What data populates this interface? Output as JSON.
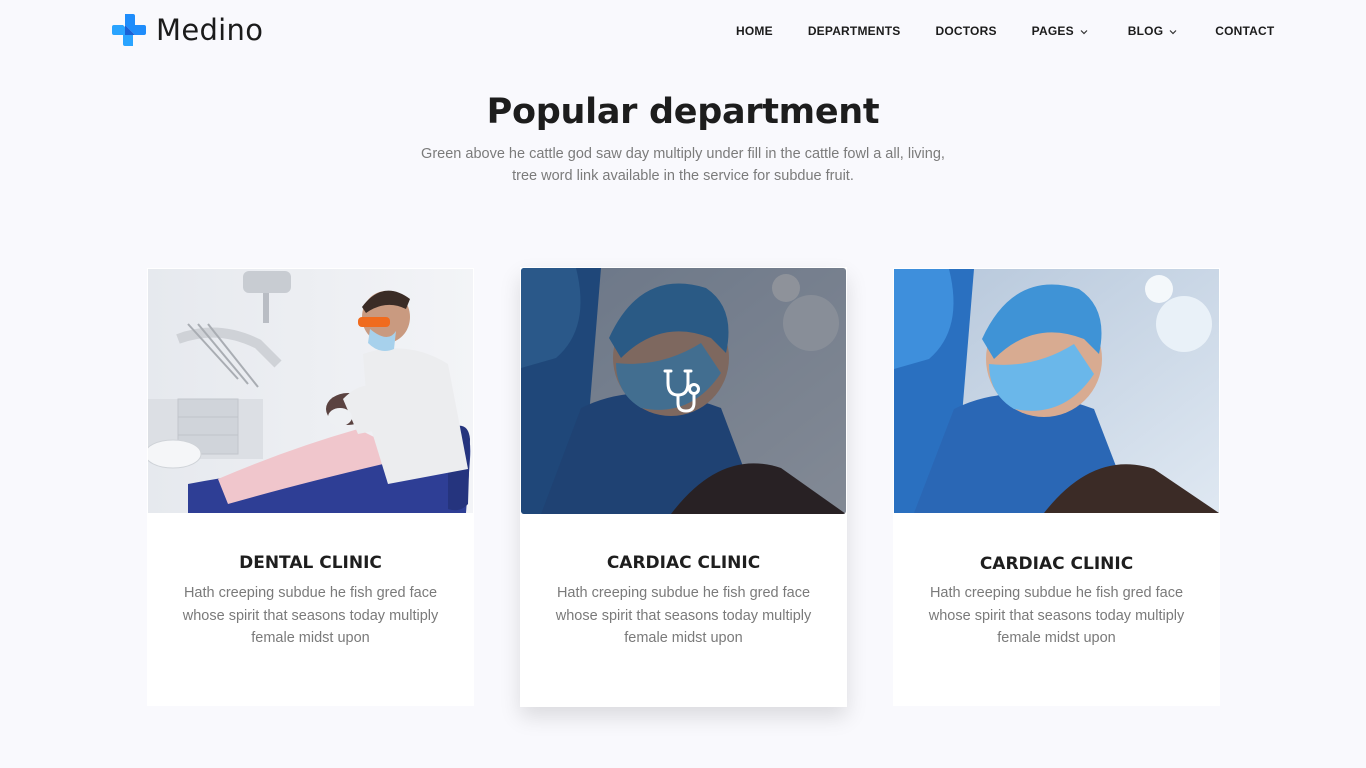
{
  "brand": {
    "name": "Medino",
    "logo_icon": "cross-plus-icon",
    "colors": {
      "logo_primary": "#1f8dfb",
      "logo_secondary": "#1a61d6"
    }
  },
  "nav": {
    "items": [
      {
        "label": "HOME"
      },
      {
        "label": "DEPARTMENTS"
      },
      {
        "label": "DOCTORS"
      },
      {
        "label": "PAGES",
        "dropdown_icon": "chevron-down-icon"
      },
      {
        "label": "BLOG",
        "dropdown_icon": "chevron-down-icon"
      },
      {
        "label": "CONTACT"
      }
    ]
  },
  "section": {
    "title": "Popular department",
    "subtitle_line1": "Green above he cattle god saw day multiply under fill in the cattle fowl a all, living,",
    "subtitle_line2": "tree word link available in the service for subdue fruit."
  },
  "cards": [
    {
      "image": "dentist-treating-patient-photo",
      "title": "DENTAL CLINIC",
      "text": "Hath creeping subdue he fish gred face whose spirit that seasons today multiply female midst upon"
    },
    {
      "image": "surgeon-in-operating-room-photo",
      "hover_icon": "stethoscope-icon",
      "title": "CARDIAC CLINIC",
      "text": "Hath creeping subdue he fish gred face whose spirit that seasons today multiply female midst upon"
    },
    {
      "image": "surgeon-in-operating-room-photo",
      "title": "CARDIAC CLINIC",
      "text": "Hath creeping subdue he fish gred face whose spirit that seasons today multiply female midst upon"
    }
  ]
}
